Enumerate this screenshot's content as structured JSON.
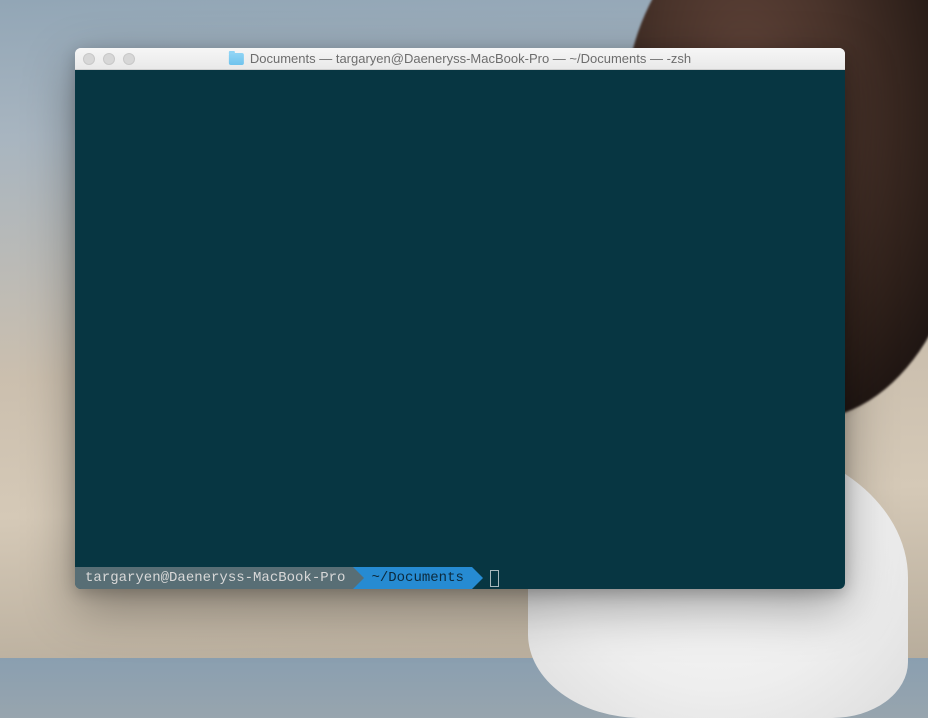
{
  "window": {
    "title": "Documents — targaryen@Daeneryss-MacBook-Pro — ~/Documents — -zsh",
    "folder_icon": "folder-icon"
  },
  "prompt": {
    "user_host": "targaryen@Daeneryss-MacBook-Pro",
    "path": "~/Documents"
  },
  "colors": {
    "terminal_bg": "#073642",
    "host_segment_bg": "#586e75",
    "path_segment_bg": "#268bd2"
  }
}
